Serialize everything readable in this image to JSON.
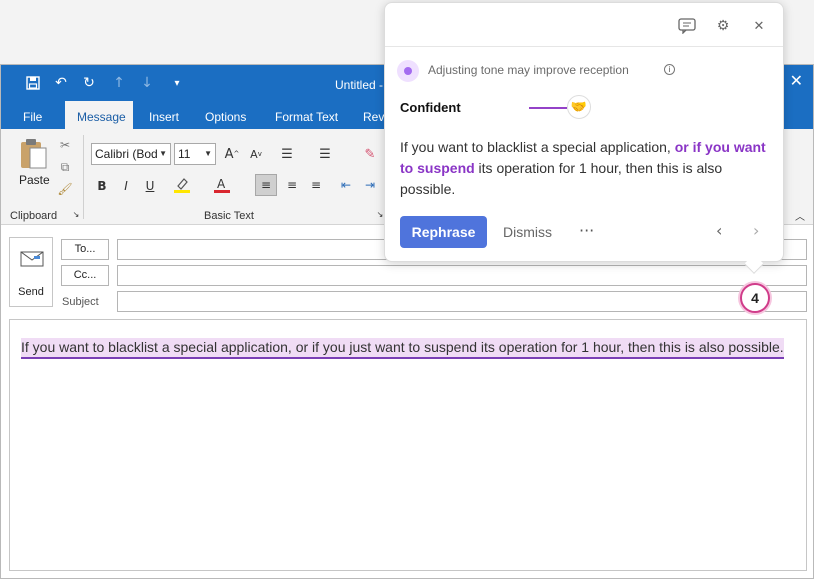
{
  "window": {
    "title": "Untitled - ",
    "quick_access": {
      "save_icon": "save-icon",
      "undo_icon": "undo-icon",
      "redo_icon": "redo-icon",
      "up_icon": "arrow-up-icon",
      "down_icon": "arrow-down-icon",
      "customize_icon": "customize-icon"
    },
    "close_glyph": "✕"
  },
  "tabs": [
    {
      "label": "File"
    },
    {
      "label": "Message"
    },
    {
      "label": "Insert"
    },
    {
      "label": "Options"
    },
    {
      "label": "Format Text"
    },
    {
      "label": "Revi"
    }
  ],
  "ribbon": {
    "clipboard": {
      "paste_label": "Paste",
      "group_label": "Clipboard"
    },
    "basic_text": {
      "font_name": "Calibri (Bod",
      "font_size": "11",
      "group_label": "Basic Text",
      "bold": "B",
      "italic": "I",
      "underline": "U"
    }
  },
  "compose": {
    "send_label": "Send",
    "to_label": "To...",
    "cc_label": "Cc...",
    "subject_label": "Subject",
    "body_text": "If you want to blacklist a special application, or if you just want to suspend its operation for 1 hour, then this is also possible."
  },
  "grammarly": {
    "tip": "Adjusting tone may improve reception",
    "tone": "Confident",
    "suggestion": {
      "before": "If you want to blacklist a special application, ",
      "highlight": "or if you want to suspend",
      "after": " its operation for 1 hour, then this is also possible."
    },
    "rephrase_label": "Rephrase",
    "dismiss_label": "Dismiss",
    "more_label": "···",
    "prev_label": "‹",
    "next_label": "›",
    "badge_count": "4",
    "accent_color": "#4f74dc",
    "highlight_color": "#8a35c6"
  }
}
